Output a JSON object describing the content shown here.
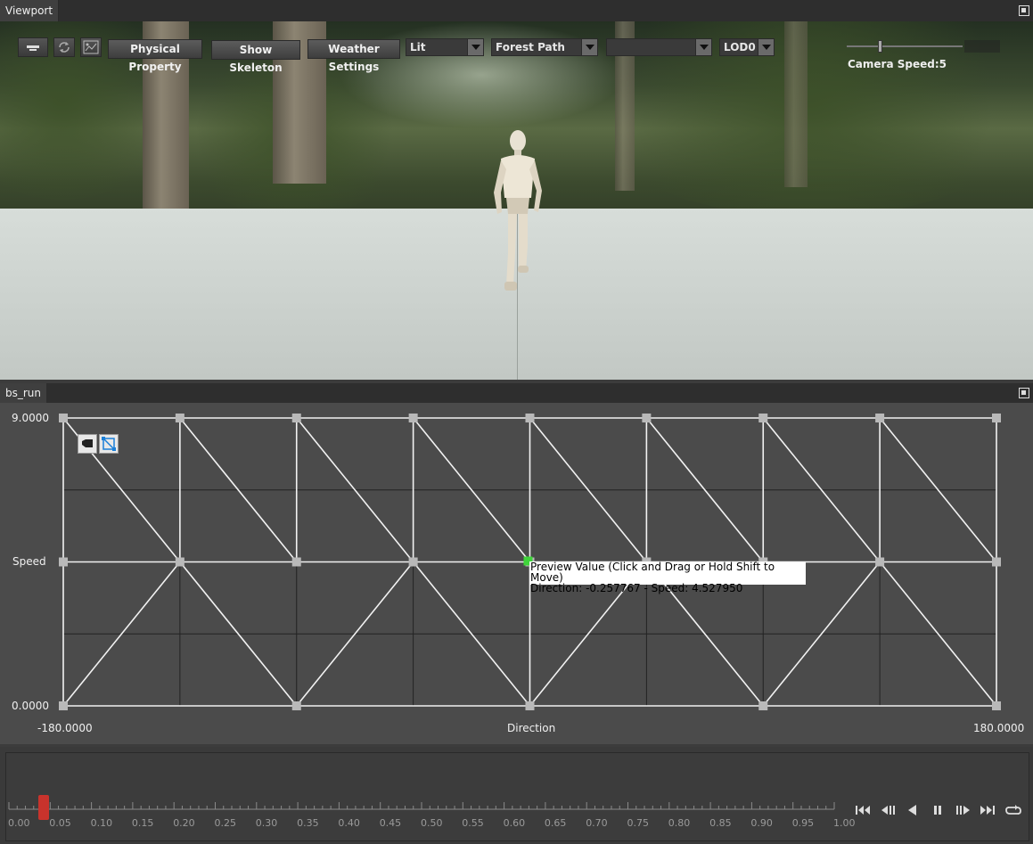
{
  "viewport": {
    "tab_label": "Viewport",
    "toolbar": {
      "physical_property_label": "Physical Property",
      "show_skeleton_label": "Show Skeleton",
      "weather_settings_label": "Weather Settings",
      "lighting_mode": "Lit",
      "environment": "Forest Path",
      "empty_combo": "",
      "lod": "LOD0"
    },
    "camera_speed_label": "Camera Speed:5"
  },
  "blendspace": {
    "tab_label": "bs_run",
    "y_axis": {
      "name": "Speed",
      "max": "9.0000",
      "min": "0.0000"
    },
    "x_axis": {
      "name": "Direction",
      "min": "-180.0000",
      "max": "180.0000"
    },
    "tooltip": {
      "line1": "Preview Value (Click and Drag or Hold Shift to Move)",
      "line2": "Direction: -0.257767 - Speed: 4.527950"
    },
    "preview_color": "#3fd43a"
  },
  "timeline": {
    "ticks": [
      "0.00",
      "0.05",
      "0.10",
      "0.15",
      "0.20",
      "0.25",
      "0.30",
      "0.35",
      "0.40",
      "0.45",
      "0.50",
      "0.55",
      "0.60",
      "0.65",
      "0.70",
      "0.75",
      "0.80",
      "0.85",
      "0.90",
      "0.95",
      "1.00"
    ],
    "playhead_value": 0.02,
    "playhead_color": "#c8332c",
    "controls": [
      "skip-start-icon",
      "step-back-icon",
      "play-reverse-icon",
      "pause-icon",
      "step-forward-icon",
      "skip-end-icon",
      "loop-icon"
    ]
  }
}
